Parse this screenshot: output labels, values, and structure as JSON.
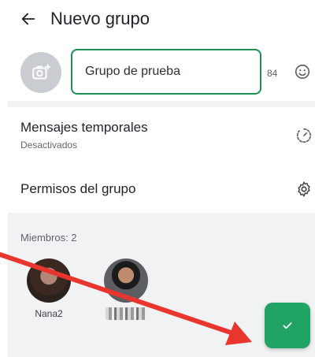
{
  "header": {
    "title": "Nuevo grupo",
    "back_icon": "arrow-left-icon"
  },
  "name_row": {
    "photo_icon": "camera-add-icon",
    "group_name_value": "Grupo de prueba",
    "char_counter": "84",
    "emoji_icon": "smiley-icon"
  },
  "settings": [
    {
      "label": "Mensajes temporales",
      "sub": "Desactivados",
      "icon": "timer-icon"
    },
    {
      "label": "Permisos del grupo",
      "icon": "gear-icon"
    }
  ],
  "members": {
    "label": "Miembros: 2",
    "items": [
      {
        "name": "Nana2"
      },
      {
        "name": "",
        "name_obscured": true
      }
    ]
  },
  "fab": {
    "icon": "check-icon"
  },
  "colors": {
    "accent": "#21a366",
    "field_border": "#1f8f53",
    "annotation_arrow": "#e8352e"
  }
}
